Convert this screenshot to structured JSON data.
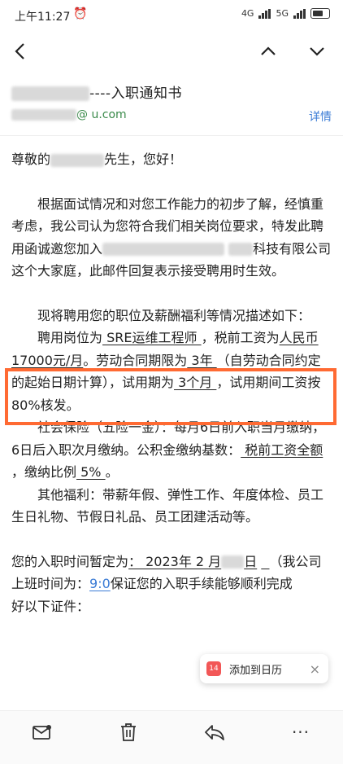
{
  "status_bar": {
    "time": "上午11:27",
    "alarm_icon": "alarm-icon",
    "network_1": "4G",
    "network_2": "5G"
  },
  "nav": {
    "back_icon": "chevron-left-icon",
    "prev_icon": "chevron-up-icon",
    "next_icon": "chevron-down-icon"
  },
  "email": {
    "subject_suffix": "----入职通知书",
    "sender_suffix": "@      u.com",
    "details_label": "详情"
  },
  "body": {
    "greeting_pre": "尊敬的",
    "greeting_post": "先生，您好！",
    "p1": "根据面试情况和对您工作能力的初步了解，经慎重考虑，我公司认为您符合我们相关岗位要求，特发此聘用函诚邀您加入",
    "p1b": "科技有限公司这个大家庭，此邮件回复表示接受聘用时生效。",
    "p2": "现将聘用您的职位及薪酬福利等情况描述如下：",
    "p3_a": "聘用岗位为",
    "p3_position": " SRE运维工程师 ",
    "p3_b": "，税前工资为",
    "p3_salary": "人民币17000元/月",
    "p3_c": "。劳动合同期限为",
    "p3_term": " 3年 ",
    "p3_d": "（自劳动合同约定的起始日期计算），试用期为",
    "p3_probation": " 3个月 ",
    "p3_e": "，试用期间工资按80%核发。",
    "p4_a": "社会保险（五险一金）：每月6日前入职当月缴纳，6日后入职次月缴纳。公积金缴纳基数：",
    "p4_base": "  税前工资全额  ",
    "p4_b": "，缴纳比例",
    "p4_ratio": "  5%  ",
    "p4_c": "。",
    "p5": "其他福利：带薪年假、弹性工作、年度体检、员工生日礼物、节假日礼品、员工团建活动等。",
    "p6_a": "您的入职时间暂定为",
    "p6_date": "： 2023年 2 月",
    "p6_day": "日",
    "p6_b": "（我公司上班时间为：",
    "p6_time": "9:0",
    "p6_c": "保证您的入职手续能够顺利完成",
    "p6_d": "好以下证件："
  },
  "toast": {
    "badge": "14",
    "label": "添加到日历",
    "close": "×"
  },
  "toolbar": {
    "mark_icon": "mail-mark-icon",
    "delete_icon": "trash-icon",
    "reply_icon": "reply-icon",
    "more_icon": "more-horizontal-icon",
    "more_label": "···"
  },
  "colors": {
    "highlight": "#ff6a33",
    "link": "#3a7bd5",
    "sender": "#3a8a4a"
  }
}
